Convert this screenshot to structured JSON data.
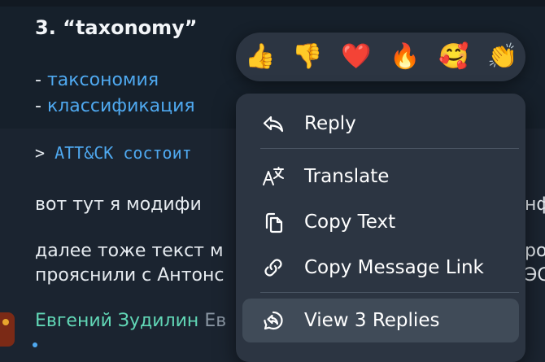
{
  "message": {
    "heading": "3. “taxonomy”",
    "list": [
      {
        "prefix": "- ",
        "text": "таксономия"
      },
      {
        "prefix": "- ",
        "text": "классификация"
      }
    ],
    "quote_prefix": "> ",
    "quote_code": "ATT&CK состоит",
    "line1": "вот тут я модифи",
    "line1_right": "нф",
    "line2": "далее тоже текст м",
    "line2_right": "ро",
    "line3": "прояснили с Антонс",
    "line3_right": "ЭС"
  },
  "author": {
    "name": "Евгений Зудилин",
    "extra": "Ев"
  },
  "reactions": [
    {
      "name": "thumbs-up",
      "emoji": "👍"
    },
    {
      "name": "thumbs-down",
      "emoji": "👎"
    },
    {
      "name": "heart",
      "emoji": "❤️"
    },
    {
      "name": "fire",
      "emoji": "🔥"
    },
    {
      "name": "smiling-face-with-hearts",
      "emoji": "🥰"
    },
    {
      "name": "clapping-hands",
      "emoji": "👏"
    }
  ],
  "menu": {
    "reply": "Reply",
    "translate": "Translate",
    "copy_text": "Copy Text",
    "copy_link": "Copy Message Link",
    "view_replies": "View 3 Replies"
  },
  "colors": {
    "background": "#1b2430",
    "menu_background": "#2c3542",
    "link": "#4fa9f0",
    "author": "#61d7b6",
    "highlight": "#404b58"
  }
}
